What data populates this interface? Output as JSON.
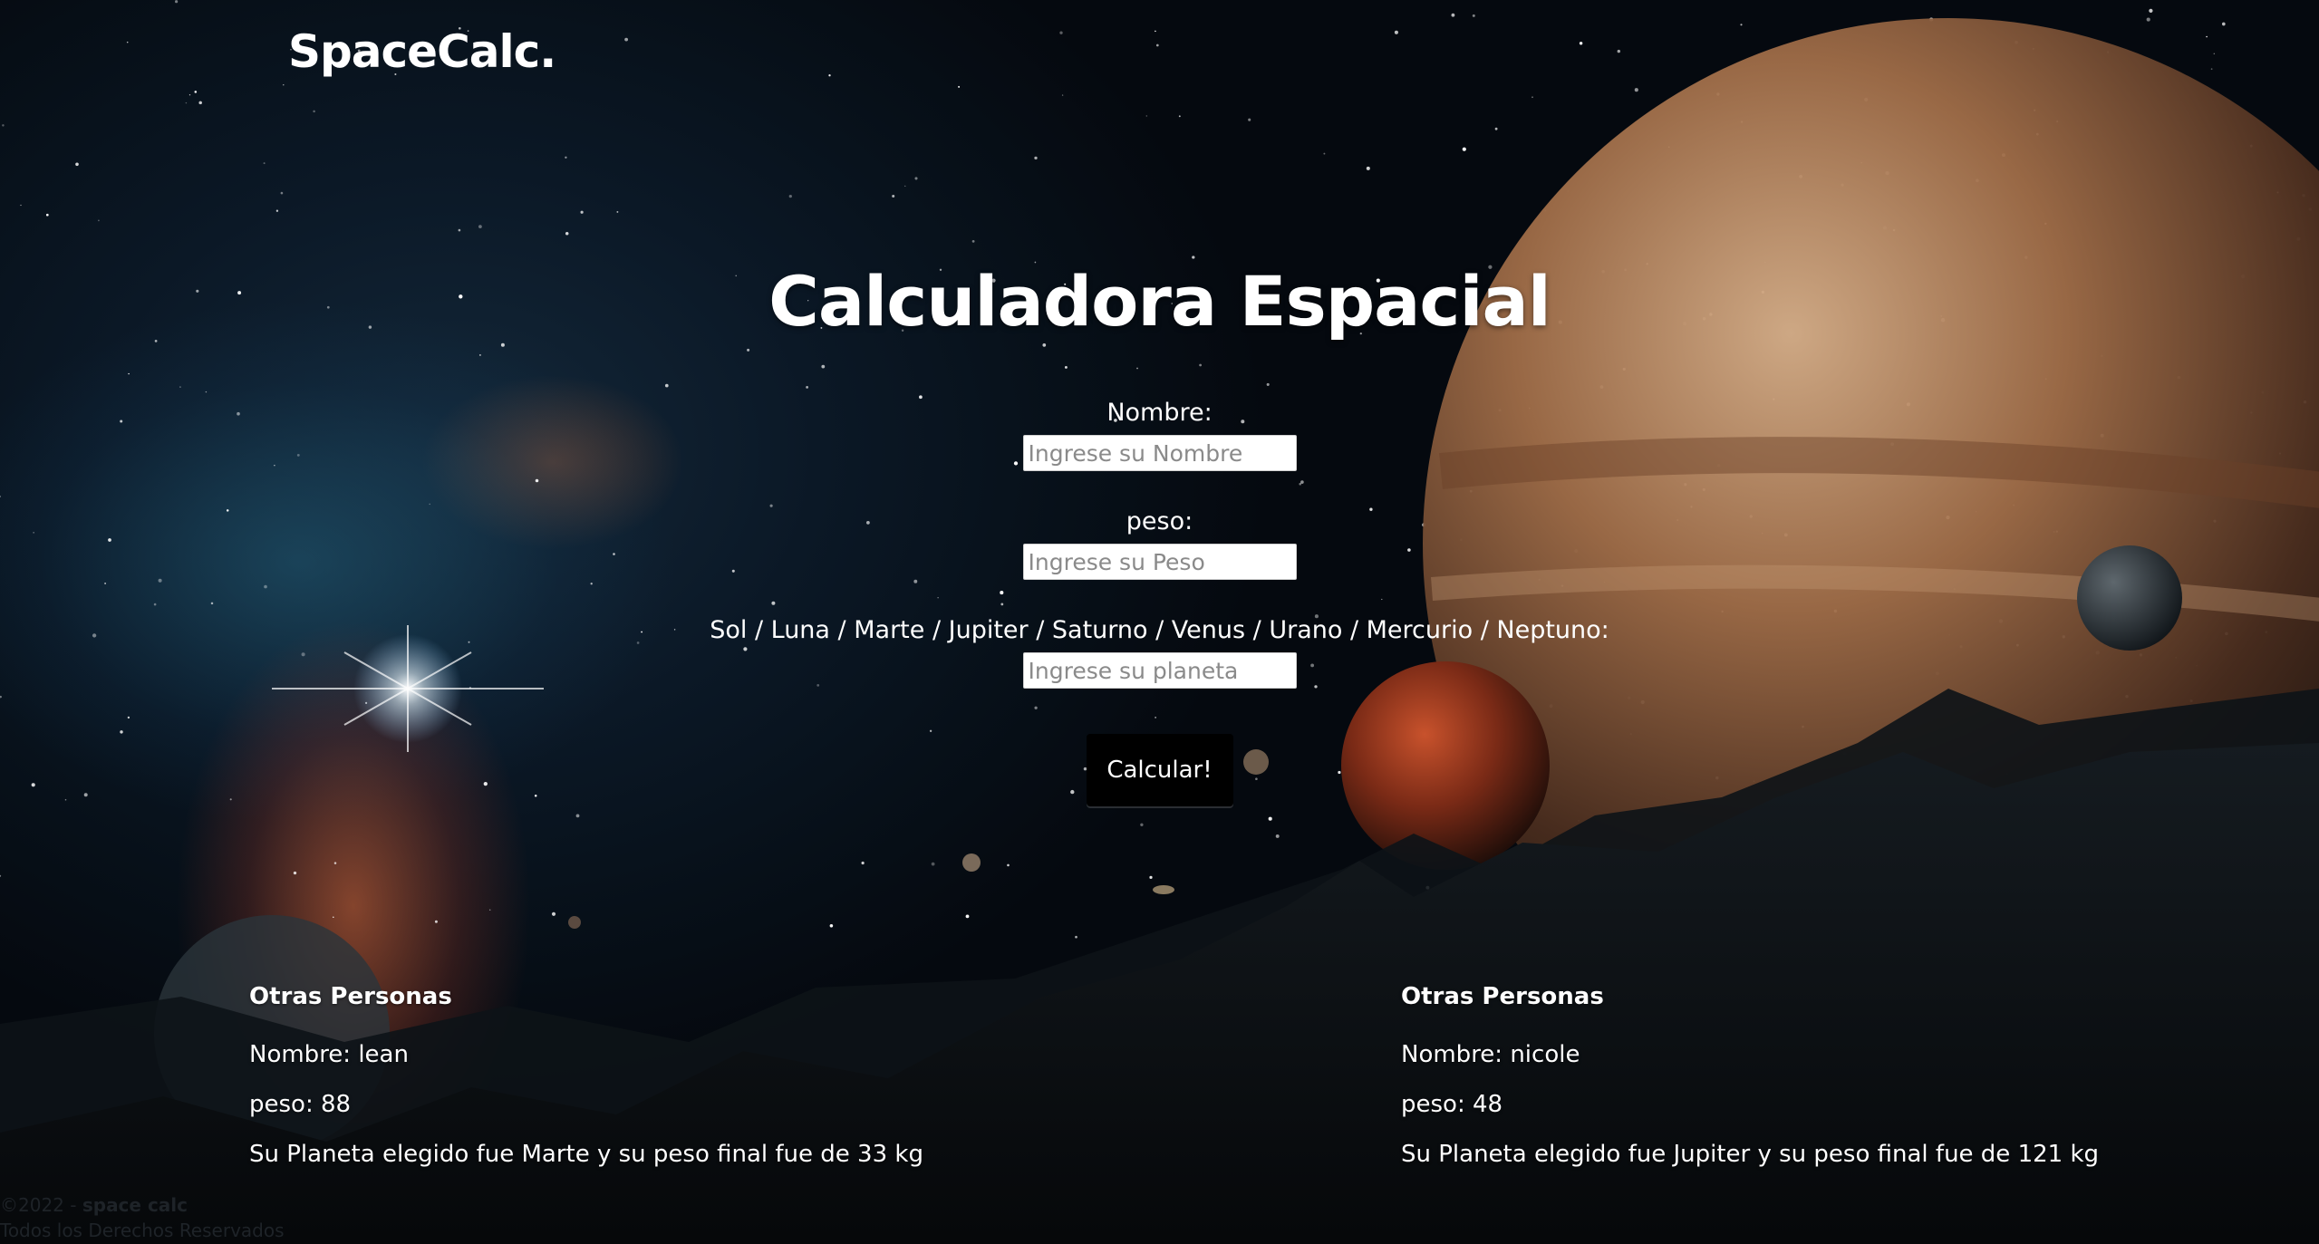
{
  "header": {
    "brand": "SpaceCalc."
  },
  "main": {
    "title": "Calculadora Espacial",
    "form": {
      "name_label": "Nombre:",
      "name_placeholder": "Ingrese su Nombre",
      "name_value": "",
      "weight_label": "peso:",
      "weight_placeholder": "Ingrese su Peso",
      "weight_value": "",
      "planet_label": "Sol / Luna / Marte / Jupiter / Saturno / Venus / Urano / Mercurio / Neptuno:",
      "planet_placeholder": "Ingrese su planeta",
      "planet_value": "",
      "submit_label": "Calcular!"
    }
  },
  "people": [
    {
      "title": "Otras Personas",
      "name_line": "Nombre: lean",
      "weight_line": "peso: 88",
      "result_line": "Su Planeta elegido fue Marte y su peso final fue de 33 kg"
    },
    {
      "title": "Otras Personas",
      "name_line": "Nombre: nicole",
      "weight_line": "peso: 48",
      "result_line": "Su Planeta elegido fue Jupiter y su peso final fue de 121 kg"
    }
  ],
  "footer": {
    "copyright_prefix": "©2022 - ",
    "copyright_brand": "space calc",
    "rights": "Todos los Derechos Reservados"
  },
  "colors": {
    "text": "#ffffff",
    "button_bg": "#000000",
    "input_bg": "#ffffff",
    "footer_text": "#1e2328",
    "space_dark": "#05090f",
    "nebula_orange": "#eb6e3c",
    "nebula_teal": "#286e8c",
    "gas_giant": "#b07a52",
    "red_planet": "#8e2e1a",
    "mountains": "#0b0e11"
  },
  "icons": {
    "background": "space-landscape-illustration"
  }
}
